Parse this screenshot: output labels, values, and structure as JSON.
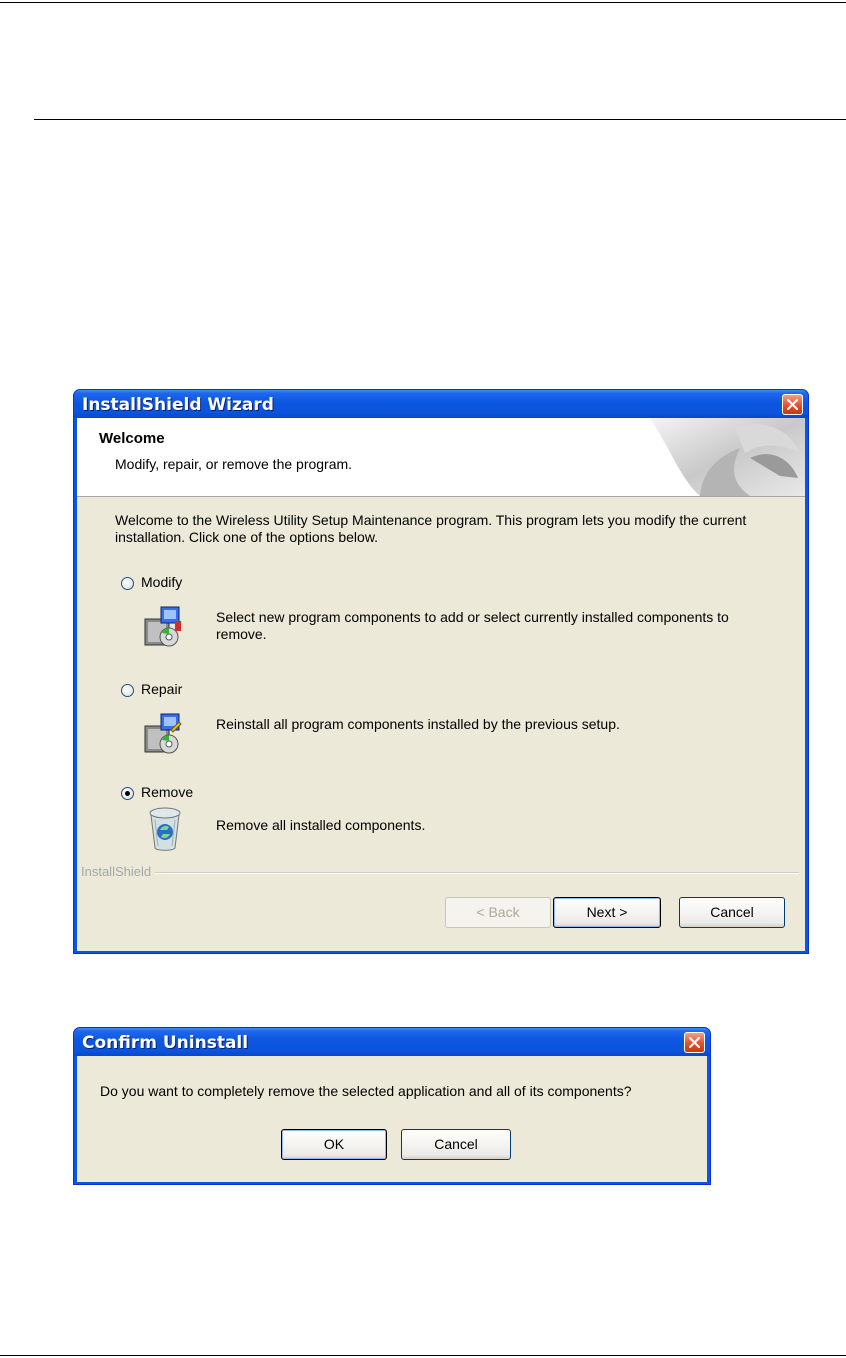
{
  "wizard": {
    "title": "InstallShield Wizard",
    "header_title": "Welcome",
    "header_subtitle": "Modify, repair, or remove the program.",
    "intro": "Welcome to the Wireless Utility Setup Maintenance program. This program lets you modify the current installation. Click one of the options below.",
    "options": [
      {
        "label": "Modify",
        "description": "Select new program components to add or select currently installed components to remove.",
        "selected": false,
        "icon": "setup-components-icon"
      },
      {
        "label": "Repair",
        "description": "Reinstall all program components installed by the previous setup.",
        "selected": false,
        "icon": "setup-repair-icon"
      },
      {
        "label": "Remove",
        "description": "Remove all installed components.",
        "selected": true,
        "icon": "recycle-bin-icon"
      }
    ],
    "brand": "InstallShield",
    "buttons": {
      "back": "< Back",
      "next": "Next >",
      "cancel": "Cancel"
    }
  },
  "confirm": {
    "title": "Confirm Uninstall",
    "message": "Do you want to completely remove the selected application and all of its components?",
    "buttons": {
      "ok": "OK",
      "cancel": "Cancel"
    }
  },
  "colors": {
    "titlebar": "#0b54dd",
    "dialog_bg": "#ece9d8",
    "close_button": "#e2512b"
  }
}
